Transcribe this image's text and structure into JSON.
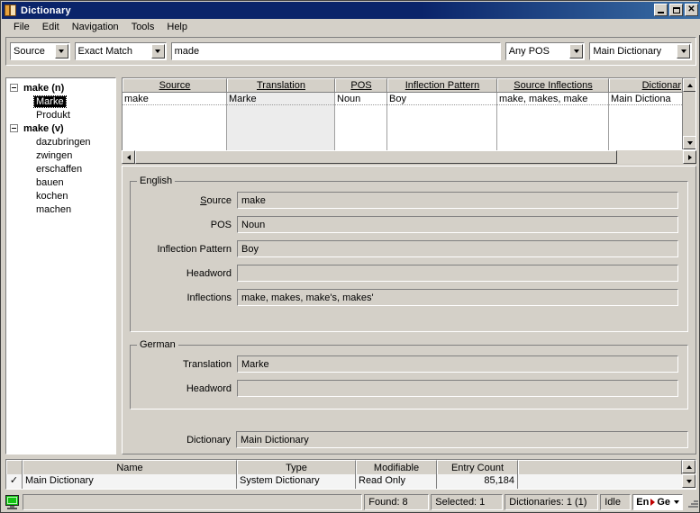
{
  "window": {
    "title": "Dictionary",
    "icon": "book-icon",
    "buttons": {
      "minimize": "_",
      "maximize": "□",
      "close": "✕"
    }
  },
  "menu": {
    "items": [
      "File",
      "Edit",
      "Navigation",
      "Tools",
      "Help"
    ]
  },
  "toolbar": {
    "field_combo": {
      "value": "Source"
    },
    "match_combo": {
      "value": "Exact Match"
    },
    "search_input": {
      "value": "made"
    },
    "pos_combo": {
      "value": "Any POS"
    },
    "dictionary_combo": {
      "value": "Main Dictionary"
    }
  },
  "tree": {
    "nodes": [
      {
        "label": "make (n)",
        "level": 0,
        "bold": true,
        "expanded": true
      },
      {
        "label": "Marke",
        "level": 1,
        "selected": true
      },
      {
        "label": "Produkt",
        "level": 1
      },
      {
        "label": "make (v)",
        "level": 0,
        "expanded": true
      },
      {
        "label": "dazubringen",
        "level": 1
      },
      {
        "label": "zwingen",
        "level": 1
      },
      {
        "label": "erschaffen",
        "level": 1
      },
      {
        "label": "bauen",
        "level": 1
      },
      {
        "label": "kochen",
        "level": 1
      },
      {
        "label": "machen",
        "level": 1
      }
    ]
  },
  "results_grid": {
    "columns": [
      {
        "label": "Source",
        "width": 116
      },
      {
        "label": "Translation",
        "width": 120,
        "selected": true
      },
      {
        "label": "POS",
        "width": 58
      },
      {
        "label": "Inflection Pattern",
        "width": 122
      },
      {
        "label": "Source Inflections",
        "width": 124
      },
      {
        "label": "Dictionar",
        "width": 83
      }
    ],
    "rows": [
      {
        "source": "make",
        "translation": "Marke",
        "pos": "Noun",
        "inflection_pattern": "Boy",
        "source_inflections": "make, makes, make",
        "dictionary": "Main Dictiona"
      }
    ]
  },
  "detail": {
    "english": {
      "legend": "English",
      "fields": [
        {
          "label": "Source",
          "mnemonic": "S",
          "value": "make"
        },
        {
          "label": "POS",
          "value": "Noun"
        },
        {
          "label": "Inflection Pattern",
          "value": "Boy"
        },
        {
          "label": "Headword",
          "value": ""
        },
        {
          "label": "Inflections",
          "value": "make, makes, make's, makes'"
        }
      ]
    },
    "german": {
      "legend": "German",
      "fields": [
        {
          "label": "Translation",
          "value": "Marke"
        },
        {
          "label": "Headword",
          "value": ""
        }
      ]
    },
    "dictionary_field": {
      "label": "Dictionary",
      "value": "Main Dictionary"
    }
  },
  "dictionary_grid": {
    "columns": [
      "Name",
      "Type",
      "Modifiable",
      "Entry Count",
      ""
    ],
    "rows": [
      {
        "checked": "✓",
        "name": "Main Dictionary",
        "type": "System Dictionary",
        "modifiable": "Read Only",
        "entry_count": "85,184",
        "extra": ""
      }
    ]
  },
  "status": {
    "message": "",
    "found": "Found: 8",
    "selected": "Selected: 1",
    "dictionaries": "Dictionaries: 1 (1)",
    "state": "Idle",
    "lang_from": "En",
    "lang_to": "Ge"
  },
  "colors": {
    "titlebar": "#0a246a",
    "face": "#d4d0c8",
    "selection": "#000000",
    "accent_red": "#c00000"
  }
}
